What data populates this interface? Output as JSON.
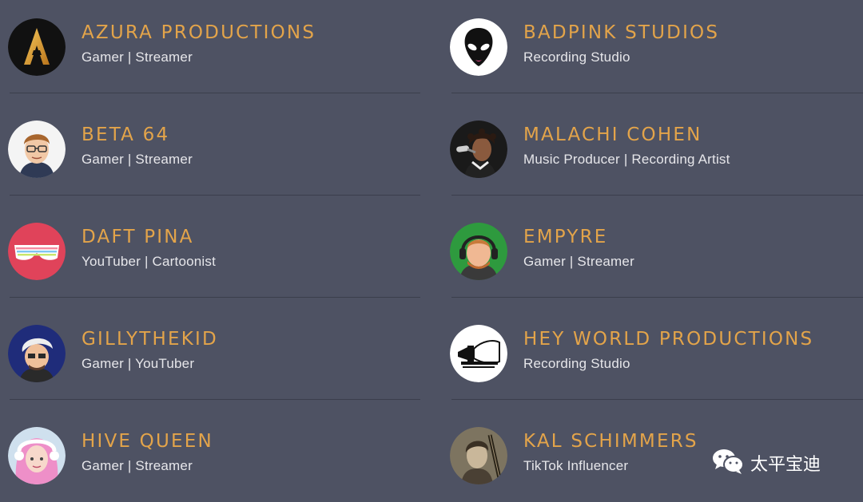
{
  "colors": {
    "background": "#4e5263",
    "name_accent": "#e3a44a",
    "role_text": "#e6e6ea",
    "divider": "#3b3e4c"
  },
  "left_column": [
    {
      "name": "AZURA PRODUCTIONS",
      "role": "Gamer | Streamer",
      "avatar_icon": "gold-a-logo-icon"
    },
    {
      "name": "BETA 64",
      "role": "Gamer | Streamer",
      "avatar_icon": "person-with-glasses-avatar"
    },
    {
      "name": "DAFT PINA",
      "role": "YouTuber | Cartoonist",
      "avatar_icon": "shutter-shades-icon"
    },
    {
      "name": "GILLYTHEKID",
      "role": "Gamer | YouTuber",
      "avatar_icon": "cartoon-character-avatar"
    },
    {
      "name": "HIVE QUEEN",
      "role": "Gamer | Streamer",
      "avatar_icon": "pink-hair-gamer-avatar"
    }
  ],
  "right_column": [
    {
      "name": "BADPINK STUDIOS",
      "role": "Recording Studio",
      "avatar_icon": "alien-head-icon"
    },
    {
      "name": "MALACHI COHEN",
      "role": "Music Producer | Recording Artist",
      "avatar_icon": "singer-with-microphone-avatar"
    },
    {
      "name": "EMPYRE",
      "role": "Gamer | Streamer",
      "avatar_icon": "person-with-headset-avatar"
    },
    {
      "name": "HEY WORLD PRODUCTIONS",
      "role": "Recording Studio",
      "avatar_icon": "megaphone-logo-icon"
    },
    {
      "name": "KAL SCHIMMERS",
      "role": "TikTok Influencer",
      "avatar_icon": "person-with-guitar-avatar"
    }
  ],
  "watermark": {
    "text": "太平宝迪",
    "icon": "wechat-icon"
  }
}
